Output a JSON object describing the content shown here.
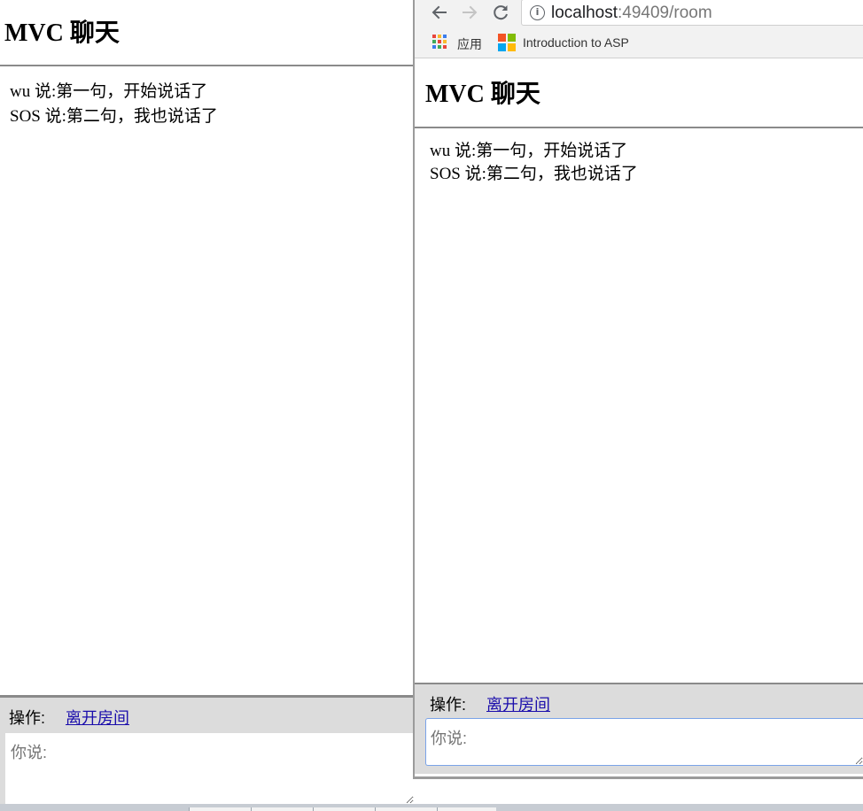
{
  "left_window": {
    "title": "MVC 聊天",
    "messages": [
      {
        "text": "wu 说:第一句，开始说话了"
      },
      {
        "text": "SOS 说:第二句，我也说话了"
      }
    ],
    "operations_label": "操作:",
    "leave_room_link": "离开房间",
    "input_placeholder": "你说:"
  },
  "browser": {
    "nav": {
      "back_icon": "arrow-left-icon",
      "forward_icon": "arrow-right-icon",
      "reload_icon": "reload-icon"
    },
    "address": {
      "info_icon": "info-icon",
      "host": "localhost",
      "path": ":49409/room"
    },
    "bookmarks": [
      {
        "icon": "apps-grid-icon",
        "label": "应用"
      },
      {
        "icon": "microsoft-logo-icon",
        "label": "Introduction to ASP"
      }
    ],
    "page": {
      "title": "MVC 聊天",
      "messages": [
        {
          "text": "wu 说:第一句，开始说话了"
        },
        {
          "text": "SOS 说:第二句，我也说话了"
        }
      ],
      "operations_label": "操作:",
      "leave_room_link": "离开房间",
      "input_placeholder": "你说:"
    }
  },
  "colors": {
    "link": "#1a0dab",
    "bar_background": "#dcdcdc",
    "rule": "#8a8a8a",
    "focus_border": "#7aa3e8",
    "ms_red": "#f35325",
    "ms_green": "#81bc06",
    "ms_blue": "#05a6f0",
    "ms_yellow": "#ffba08"
  }
}
